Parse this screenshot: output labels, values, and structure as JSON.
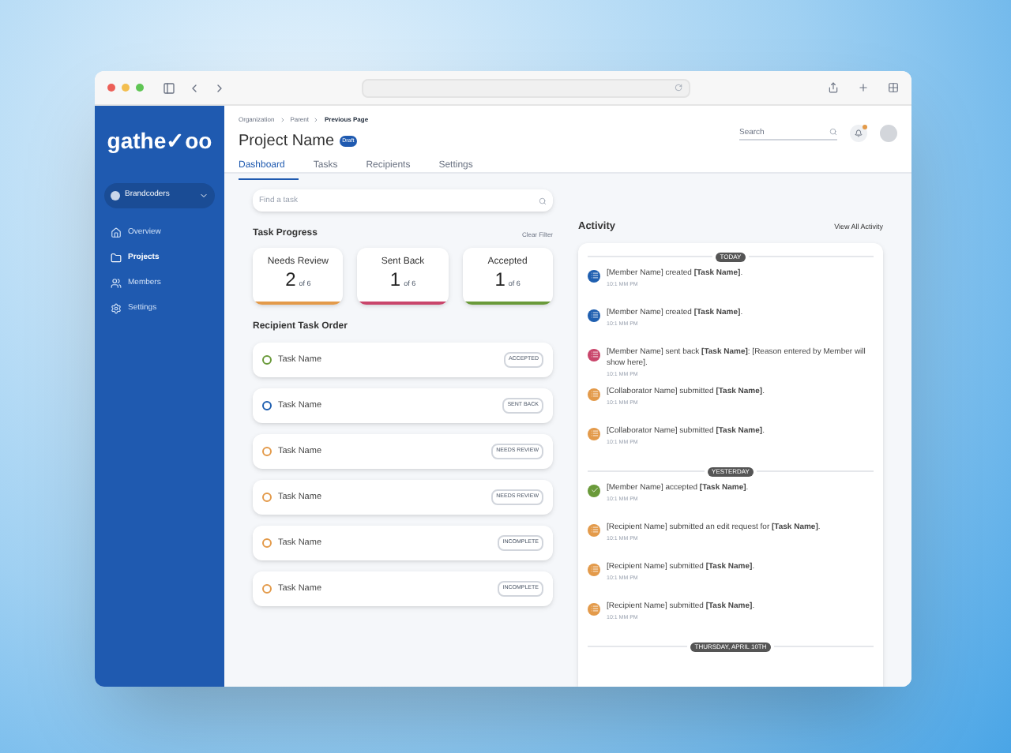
{
  "sidebar": {
    "logo": "gathe✓oo",
    "workspace": "Brandcoders",
    "items": [
      {
        "label": "Overview",
        "selected": false,
        "kind": "home"
      },
      {
        "label": "Projects",
        "selected": true,
        "kind": "folder"
      },
      {
        "label": "Members",
        "selected": false,
        "kind": "users"
      },
      {
        "label": "Settings",
        "selected": false,
        "kind": "gear"
      }
    ]
  },
  "header": {
    "breadcrumb": [
      "Organization",
      "Parent",
      "Previous Page"
    ],
    "title": "Project Name",
    "badge": "Draft",
    "search": {
      "placeholder": "Search"
    },
    "tabs": [
      {
        "label": "Dashboard",
        "selected": true
      },
      {
        "label": "Tasks",
        "selected": false
      },
      {
        "label": "Recipients",
        "selected": false
      },
      {
        "label": "Settings",
        "selected": false
      }
    ]
  },
  "tasks_panel": {
    "search": {
      "placeholder": "Find a task"
    },
    "progress_title": "Task Progress",
    "clear_filter": "Clear Filter",
    "cards": [
      {
        "label": "Needs Review",
        "count": "2",
        "total": "of 6",
        "color": "#e39a4a"
      },
      {
        "label": "Sent Back",
        "count": "1",
        "total": "of 6",
        "color": "#c9456b"
      },
      {
        "label": "Accepted",
        "count": "1",
        "total": "of 6",
        "color": "#6a9a3a"
      }
    ],
    "order_title": "Recipient Task Order",
    "rows": [
      {
        "name": "Task Name",
        "status": "ACCEPTED",
        "color": "#6a9a3a"
      },
      {
        "name": "Task Name",
        "status": "SENT BACK",
        "color": "#1f5fb0"
      },
      {
        "name": "Task Name",
        "status": "NEEDS REVIEW",
        "color": "#e39a4a"
      },
      {
        "name": "Task Name",
        "status": "NEEDS REVIEW",
        "color": "#e39a4a"
      },
      {
        "name": "Task Name",
        "status": "INCOMPLETE",
        "color": "#e39a4a"
      },
      {
        "name": "Task Name",
        "status": "INCOMPLETE",
        "color": "#e39a4a"
      }
    ]
  },
  "activity": {
    "title": "Activity",
    "view_all": "View All Activity",
    "items": [
      {
        "kind": "divider",
        "label": "TODAY"
      },
      {
        "kind": "entry",
        "text": "[Member Name] created **[Task Name]**.",
        "time": "10:1 MM PM",
        "color": "#1f5fb0"
      },
      {
        "kind": "entry",
        "text": "[Member Name] created **[Task Name]**.",
        "time": "10:1 MM PM",
        "color": "#1f5fb0"
      },
      {
        "kind": "entry",
        "text": "[Member Name] sent back **[Task Name]**: [Reason entered by Member will show here].",
        "time": "10:1 MM PM",
        "color": "#c9456b"
      },
      {
        "kind": "entry",
        "text": "[Collaborator Name] submitted **[Task Name]**.",
        "time": "10:1 MM PM",
        "color": "#e39a4a"
      },
      {
        "kind": "entry",
        "text": "[Collaborator Name] submitted **[Task Name]**.",
        "time": "10:1 MM PM",
        "color": "#e39a4a"
      },
      {
        "kind": "divider",
        "label": "YESTERDAY"
      },
      {
        "kind": "check",
        "text": "[Member Name] accepted **[Task Name]**.",
        "time": "10:1 MM PM",
        "color": "#6a9a3a"
      },
      {
        "kind": "entry",
        "text": "[Recipient Name] submitted an edit request for **[Task Name]**.",
        "time": "10:1 MM PM",
        "color": "#e39a4a"
      },
      {
        "kind": "entry",
        "text": "[Recipient Name] submitted **[Task Name]**.",
        "time": "10:1 MM PM",
        "color": "#e39a4a"
      },
      {
        "kind": "entry",
        "text": "[Recipient Name] submitted **[Task Name]**.",
        "time": "10:1 MM PM",
        "color": "#e39a4a"
      },
      {
        "kind": "divider",
        "label": "THURSDAY, APRIL 10TH"
      }
    ]
  }
}
